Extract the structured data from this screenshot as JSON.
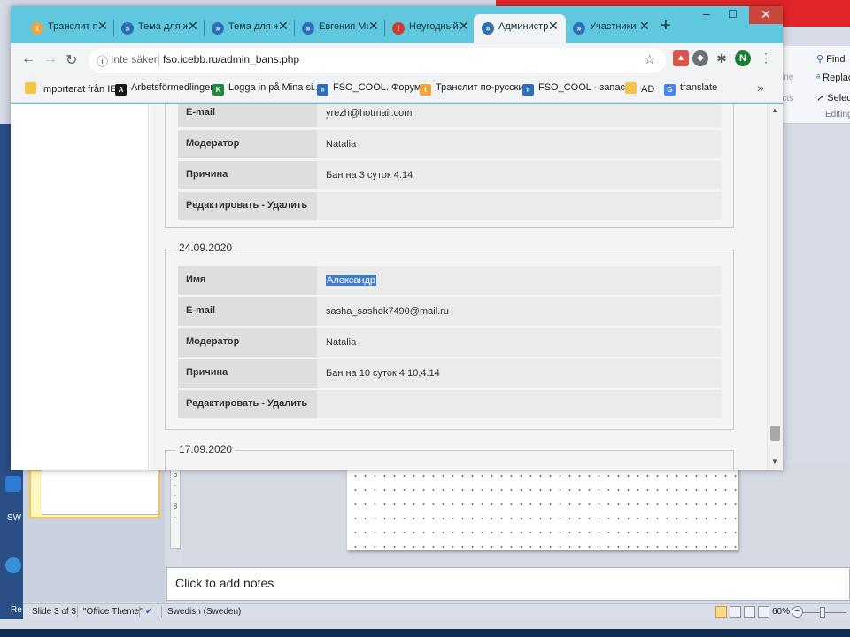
{
  "powerpoint": {
    "ribbon": {
      "find_label": "Find",
      "replace_label": "Replac",
      "select_label": "Select",
      "editing_group_label": "Editing",
      "outline_dim": "tline",
      "effects_dim": "ects"
    },
    "notes_placeholder": "Click to add notes",
    "status": {
      "slide_info": "Slide 3 of 3",
      "theme": "\"Office Theme\"",
      "language": "Swedish (Sweden)",
      "zoom": "60%"
    },
    "desktop_labels": [
      "SW",
      "Re"
    ]
  },
  "browser": {
    "tabs": [
      {
        "title": "Транслит по-русски",
        "favicon": "transliterate-icon",
        "color": "#f2a33a",
        "glyph": "t",
        "active": false
      },
      {
        "title": "Тема для жалоб",
        "favicon": "forum-icon",
        "color": "#2b6fb8",
        "glyph": "»",
        "active": false
      },
      {
        "title": "Тема для жалоб",
        "favicon": "forum-icon",
        "color": "#2b6fb8",
        "glyph": "»",
        "active": false
      },
      {
        "title": "Евгения Мел",
        "favicon": "forum-icon",
        "color": "#2b6fb8",
        "glyph": "»",
        "active": false
      },
      {
        "title": "Неугодный пост",
        "favicon": "alert-icon",
        "color": "#d33a2c",
        "glyph": "!",
        "active": false
      },
      {
        "title": "Администрирование",
        "favicon": "forum-icon",
        "color": "#2b6fb8",
        "glyph": "»",
        "active": true
      },
      {
        "title": "Участники",
        "favicon": "forum-icon",
        "color": "#2b6fb8",
        "glyph": "»",
        "active": false
      }
    ],
    "security_label": "Inte säker",
    "url": "fso.icebb.ru/admin_bans.php",
    "profile_initial": "N",
    "bookmarks": [
      {
        "label": "Importerat från IE",
        "icon": "folder-icon",
        "color": "#f4c542",
        "glyph": ""
      },
      {
        "label": "Arbetsförmedlingen",
        "icon": "arbetsformedlingen-icon",
        "color": "#1a1a1a",
        "glyph": "A"
      },
      {
        "label": "Logga in på Mina si...",
        "icon": "login-icon",
        "color": "#1f8a3b",
        "glyph": "K"
      },
      {
        "label": "FSO_COOL. Форум...",
        "icon": "forum-icon",
        "color": "#2b6fb8",
        "glyph": "»"
      },
      {
        "label": "Транслит по-русски",
        "icon": "transliterate-icon",
        "color": "#f2a33a",
        "glyph": "t"
      },
      {
        "label": "FSO_COOL - запас...",
        "icon": "forum-icon",
        "color": "#2b6fb8",
        "glyph": "»"
      },
      {
        "label": "AD",
        "icon": "folder-icon",
        "color": "#f4c542",
        "glyph": ""
      },
      {
        "label": "translate",
        "icon": "google-icon",
        "color": "#4285f4",
        "glyph": "G"
      }
    ]
  },
  "page": {
    "labels": {
      "name": "Имя",
      "email": "E-mail",
      "moderator": "Модератор",
      "reason": "Причина",
      "edit": "Редактировать",
      "delete": "Удалить",
      "separator": " - "
    },
    "bans": [
      {
        "date": "",
        "email": "yrezh@hotmail.com",
        "moderator": "Natalia",
        "reason": "Бан на 3 суток 4.14"
      },
      {
        "date": "24.09.2020",
        "name": "Александр",
        "email": "sasha_sashok7490@mail.ru",
        "moderator": "Natalia",
        "reason": "Бан на 10 суток 4.10,4.14"
      },
      {
        "date": "17.09.2020"
      }
    ]
  }
}
